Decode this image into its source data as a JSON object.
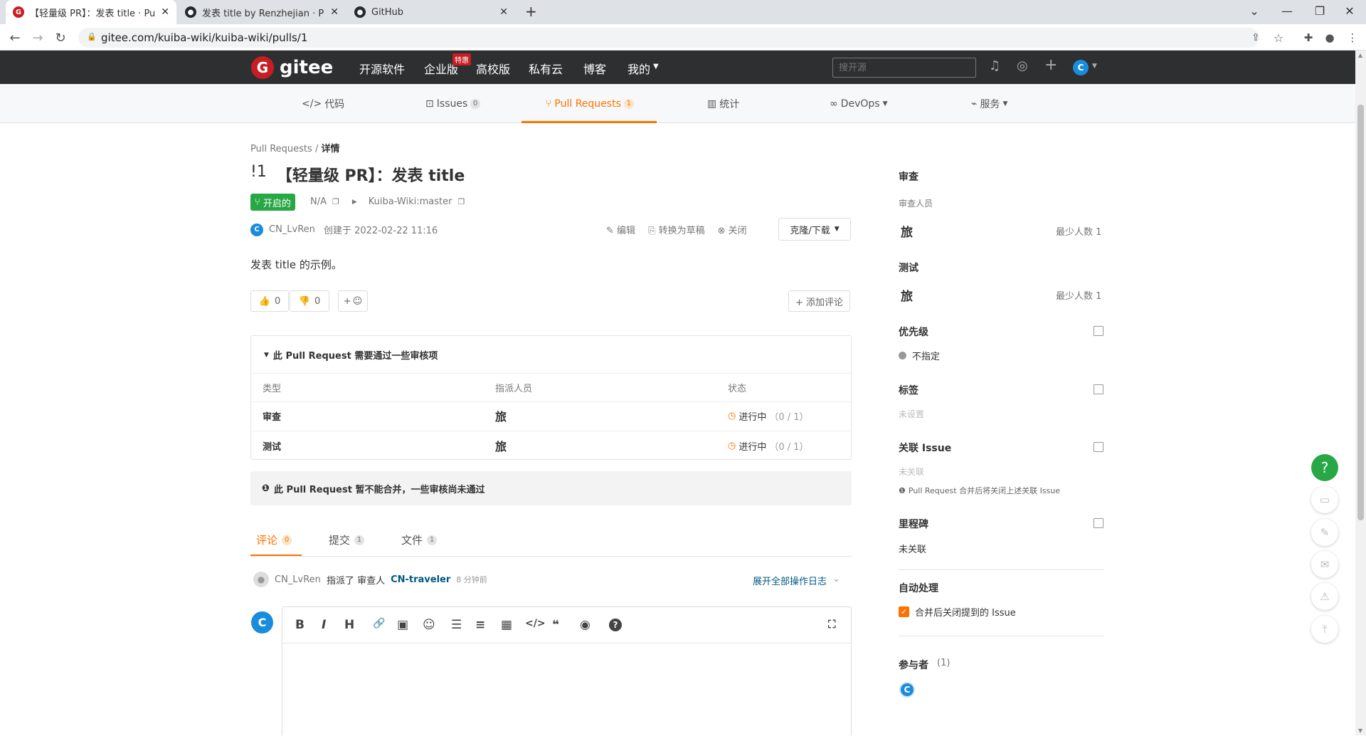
{
  "browser": {
    "tabs": [
      {
        "title": "【轻量级 PR】：发表 title · Pull",
        "icon": "gitee-icon",
        "active": true
      },
      {
        "title": "发表 title by Renzhejian · Pull R",
        "icon": "github-icon",
        "active": false
      },
      {
        "title": "GitHub",
        "icon": "github-icon",
        "active": false
      }
    ],
    "new_tab": "+",
    "url": "gitee.com/kuiba-wiki/kuiba-wiki/pulls/1"
  },
  "header": {
    "logo_text": "gitee",
    "nav": [
      "开源软件",
      "企业版",
      "高校版",
      "私有云",
      "博客",
      "我的"
    ],
    "badge": "特惠",
    "search_placeholder": "搜开源",
    "avatar": "C"
  },
  "subnav": {
    "items": [
      {
        "label": "代码",
        "icon": "code-icon"
      },
      {
        "label": "Issues",
        "count": "0",
        "icon": "issue-icon"
      },
      {
        "label": "Pull Requests",
        "count": "1",
        "icon": "pr-icon",
        "active": true
      },
      {
        "label": "统计",
        "icon": "chart-icon"
      },
      {
        "label": "DevOps",
        "icon": "infinity-icon"
      },
      {
        "label": "服务",
        "icon": "pulse-icon"
      }
    ]
  },
  "pr": {
    "breadcrumb": [
      "Pull Requests",
      "详情"
    ],
    "number": "!1",
    "title": "【轻量级 PR】：发表 title",
    "status": "开启的",
    "source": "N/A",
    "target": "Kuiba-Wiki:master",
    "author": "CN_LvRen",
    "created": "创建于 2022-02-22 11:16",
    "actions": [
      "编辑",
      "转换为草稿",
      "关闭"
    ],
    "clone_label": "克隆/下载",
    "description": "发表 title 的示例。",
    "thumbs_up": "0",
    "thumbs_down": "0",
    "emoji_add": "+",
    "add_comment": "+ 添加评论"
  },
  "review": {
    "heading": "此 Pull Request 需要通过一些审核项",
    "columns": [
      "类型",
      "指派人员",
      "状态"
    ],
    "rows": [
      {
        "type": "审查",
        "assignee": "旅",
        "status": "进行中",
        "progress": "（0 / 1）"
      },
      {
        "type": "测试",
        "assignee": "旅",
        "status": "进行中",
        "progress": "（0 / 1）"
      }
    ],
    "merge_notice": "此 Pull Request 暂不能合并，一些审核尚未通过"
  },
  "tabs": [
    {
      "label": "评论",
      "count": "0",
      "active": true
    },
    {
      "label": "提交",
      "count": "1"
    },
    {
      "label": "文件",
      "count": "1"
    }
  ],
  "activity": {
    "user": "CN_LvRen",
    "action": "指派了 审查人",
    "target": "CN-traveler",
    "time": "8 分钟前",
    "expand": "展开全部操作日志"
  },
  "editor": {
    "avatar": "C",
    "tools": [
      "B",
      "I",
      "H",
      "🔗",
      "▣",
      "☺",
      "☰",
      "≡",
      "▦",
      "</>",
      "❝",
      "◉",
      "?"
    ],
    "fullscreen": "⛶"
  },
  "sidebar": {
    "review_title": "审查",
    "reviewer_label": "审查人员",
    "reviewer": "旅",
    "reviewer_min": "最少人数 1",
    "test_title": "测试",
    "tester": "旅",
    "tester_min": "最少人数 1",
    "priority_title": "优先级",
    "priority_value": "不指定",
    "label_title": "标签",
    "label_value": "未设置",
    "issue_title": "关联 Issue",
    "issue_value": "未关联",
    "issue_hint": "Pull Request 合并后将关闭上述关联 Issue",
    "milestone_title": "里程碑",
    "milestone_value": "未关联",
    "auto_title": "自动处理",
    "auto_option": "合并后关闭提到的 Issue",
    "participants_title": "参与者",
    "participants_count": "(1)",
    "participant": "C"
  },
  "fab": {
    "help": "?"
  },
  "colors": {
    "brand": "#c71d23",
    "accent": "#fe7300",
    "success": "#28a745",
    "header": "#2e2f31"
  }
}
